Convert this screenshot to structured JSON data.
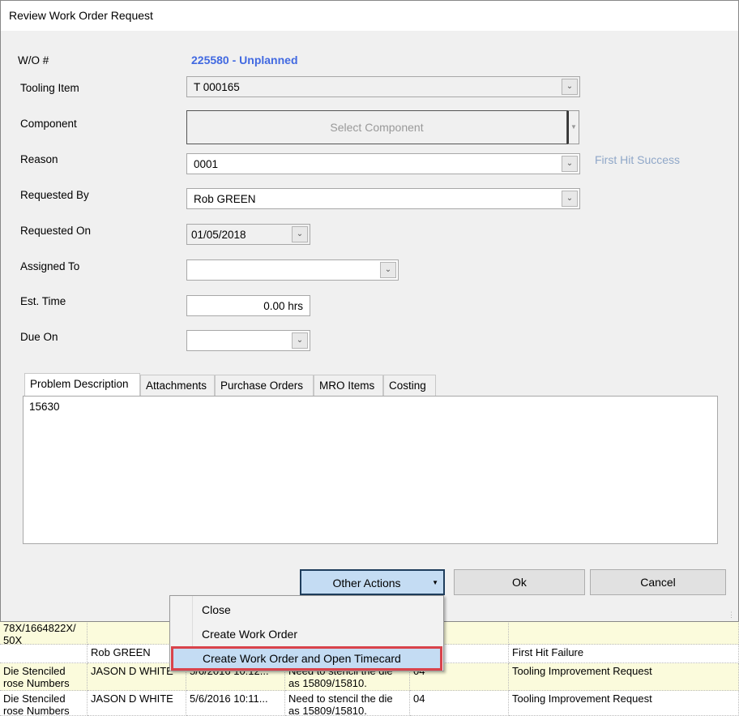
{
  "window": {
    "title": "Review Work Order Request"
  },
  "form": {
    "wo_label": "W/O #",
    "wo_value": "225580 - Unplanned",
    "tooling_label": "Tooling Item",
    "tooling_value": "T 000165",
    "component_label": "Component",
    "component_button": "Select Component",
    "reason_label": "Reason",
    "reason_value": "0001",
    "reason_note": "First Hit Success",
    "requested_by_label": "Requested By",
    "requested_by_value": "Rob GREEN",
    "requested_on_label": "Requested On",
    "requested_on_value": "01/05/2018",
    "assigned_to_label": "Assigned To",
    "assigned_to_value": "",
    "est_time_label": "Est. Time",
    "est_time_value": "0.00 hrs",
    "due_on_label": "Due On",
    "due_on_value": ""
  },
  "tabs": [
    {
      "label": "Problem Description"
    },
    {
      "label": "Attachments"
    },
    {
      "label": "Purchase Orders"
    },
    {
      "label": "MRO Items"
    },
    {
      "label": "Costing"
    }
  ],
  "problem_description": "15630",
  "buttons": {
    "other_actions": "Other Actions",
    "ok": "Ok",
    "cancel": "Cancel"
  },
  "menu": {
    "items": [
      {
        "label": "Close"
      },
      {
        "label": "Create Work Order"
      },
      {
        "label": "Create Work Order and Open Timecard"
      }
    ]
  },
  "background_grid": {
    "rows": [
      [
        "78X/1664822X/\n50X",
        "",
        "",
        "",
        "",
        ""
      ],
      [
        "",
        "Rob  GREEN",
        "",
        "",
        "",
        "First Hit Failure"
      ],
      [
        "Die Stenciled\nrose Numbers",
        "JASON D WHITE",
        "5/6/2016  10:12...",
        "Need to stencil the die\nas 15809/15810.",
        "04",
        "Tooling Improvement Request"
      ],
      [
        "Die Stenciled\nrose Numbers",
        "JASON D WHITE",
        "5/6/2016  10:11...",
        "Need to stencil the die\nas 15809/15810.",
        "04",
        "Tooling Improvement Request"
      ]
    ]
  },
  "colors": {
    "wo_link": "#4169e1",
    "highlight": "#c4dcf3",
    "highlight_border": "#d9434b",
    "grid_yellow": "#fbfbdc"
  }
}
